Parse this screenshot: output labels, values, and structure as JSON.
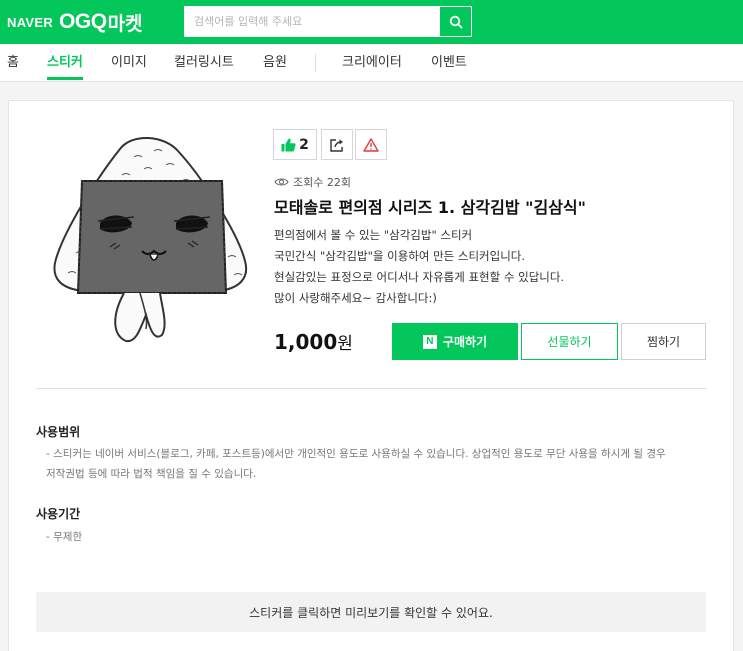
{
  "header": {
    "logo_naver": "NAVER",
    "logo_ogq": "OGQ",
    "logo_market": "마켓",
    "search_placeholder": "검색어를 입력해 주세요",
    "brand_color": "#03c75a"
  },
  "nav": {
    "items": [
      {
        "label": "홈",
        "active": false
      },
      {
        "label": "스티커",
        "active": true
      },
      {
        "label": "이미지",
        "active": false
      },
      {
        "label": "컬러링시트",
        "active": false
      },
      {
        "label": "음원",
        "active": false
      },
      {
        "label": "크리에이터",
        "active": false
      },
      {
        "label": "이벤트",
        "active": false
      }
    ]
  },
  "product": {
    "like_count": "2",
    "views": "조회수 22회",
    "title": "모태솔로 편의점 시리즈 1. 삼각김밥 \"김삼식\"",
    "description": [
      "편의점에서 볼 수 있는 \"삼각김밥\" 스티커",
      "국민간식 \"삼각김밥\"을 이용하여 만든 스티커입니다.",
      "현실감있는 표정으로 어디서나 자유롭게 표현할 수 있답니다.",
      "많이 사랑해주세요~ 감사합니다:)"
    ],
    "price": "1,000",
    "price_unit": "원",
    "buy_label": "구매하기",
    "buy_badge": "N",
    "gift_label": "선물하기",
    "wish_label": "찜하기"
  },
  "usage": {
    "scope_title": "사용범위",
    "scope_text_1": "- 스티커는 네이버 서비스(블로그, 카페, 포스트등)에서만 개인적인 용도로 사용하실 수 있습니다. 상업적인 용도로 무단 사용을 하시게 될 경우",
    "scope_text_2": "저작권법 등에 따라 법적 책임을 질 수 있습니다.",
    "period_title": "사용기간",
    "period_text": "- 무제한"
  },
  "preview_hint": "스티커를 클릭하면 미리보기를 확인할 수 있어요."
}
